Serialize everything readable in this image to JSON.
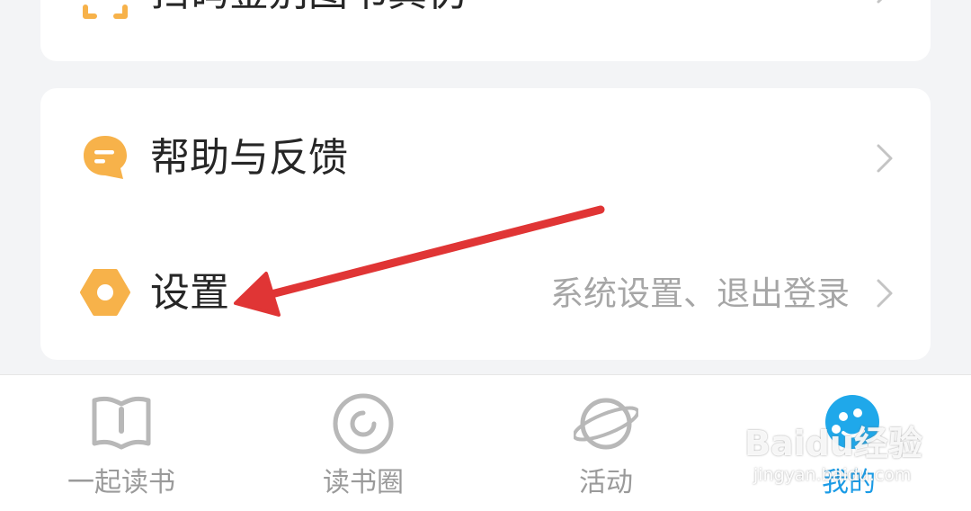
{
  "top_card": {
    "label": "扫码鉴别图书真伪"
  },
  "menu": {
    "items": [
      {
        "label": "帮助与反馈",
        "sub": "",
        "icon": "feedback-icon"
      },
      {
        "label": "设置",
        "sub": "系统设置、退出登录",
        "icon": "settings-hex-icon"
      }
    ]
  },
  "tabbar": {
    "tabs": [
      {
        "label": "一起读书",
        "icon": "book-icon",
        "active": false
      },
      {
        "label": "读书圈",
        "icon": "circle-refresh-icon",
        "active": false
      },
      {
        "label": "活动",
        "icon": "planet-icon",
        "active": false
      },
      {
        "label": "我的",
        "icon": "mascot-avatar-icon",
        "active": true
      }
    ]
  },
  "watermark": {
    "main": "Baidu经验",
    "sub": "jingyan.baidu.com"
  },
  "colors": {
    "accent_orange": "#f7b24a",
    "active_tab": "#1a9be6",
    "annotation_arrow": "#e03535"
  }
}
